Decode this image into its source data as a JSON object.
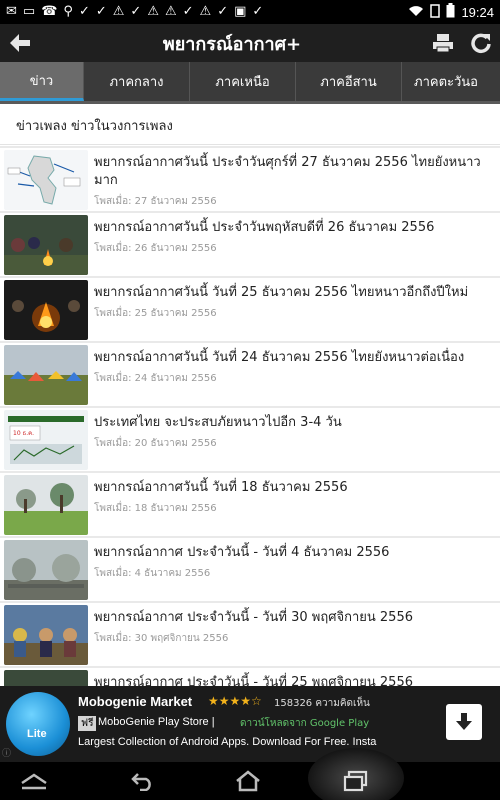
{
  "status_bar": {
    "left_icons": [
      "✉",
      "▭",
      "☎",
      "⚲",
      "✓",
      "✓",
      "⚠",
      "✓",
      "⚠",
      "⚠",
      "✓",
      "⚠",
      "✓",
      "▣",
      "✓"
    ],
    "time": "19:24"
  },
  "action_bar": {
    "title": "พยากรณ์อากาศ+",
    "back_icon": "arrow-left-icon",
    "print_icon": "printer-icon",
    "refresh_icon": "refresh-icon"
  },
  "tabs": [
    {
      "label": "ข่าว",
      "active": true
    },
    {
      "label": "ภาคกลาง",
      "active": false
    },
    {
      "label": "ภาคเหนือ",
      "active": false
    },
    {
      "label": "ภาคอีสาน",
      "active": false
    },
    {
      "label": "ภาคตะวันอ",
      "active": false
    }
  ],
  "section_title": "ข่าวเพลง ข่าวในวงการเพลง",
  "news": [
    {
      "headline": "พยากรณ์อากาศวันนี้ ประจำวันศุกร์ที่ 27 ธันวาคม 2556 ไทยยังหนาวมาก",
      "date": "โพสเมื่อ: 27 ธันวาคม 2556",
      "thumb": "map"
    },
    {
      "headline": "พยากรณ์อากาศวันนี้ ประจำวันพฤหัสบดีที่ 26 ธันวาคม 2556",
      "date": "โพสเมื่อ: 26 ธันวาคม 2556",
      "thumb": "fire"
    },
    {
      "headline": "พยากรณ์อากาศวันนี้ วันที่ 25 ธันวาคม 2556 ไทยหนาวอีกถึงปีใหม่",
      "date": "โพสเมื่อ: 25 ธันวาคม 2556",
      "thumb": "fire2"
    },
    {
      "headline": "พยากรณ์อากาศวันนี้ วันที่ 24 ธันวาคม 2556 ไทยยังหนาวต่อเนื่อง",
      "date": "โพสเมื่อ: 24 ธันวาคม 2556",
      "thumb": "tents"
    },
    {
      "headline": "ประเทศไทย จะประสบภัยหนาวไปอีก 3-4 วัน",
      "date": "โพสเมื่อ: 20 ธันวาคม 2556",
      "thumb": "chart"
    },
    {
      "headline": "พยากรณ์อากาศวันนี้ วันที่ 18 ธันวาคม 2556",
      "date": "โพสเมื่อ: 18 ธันวาคม 2556",
      "thumb": "fog"
    },
    {
      "headline": "พยากรณ์อากาศ ประจำวันนี้ - วันที่ 4 ธันวาคม 2556",
      "date": "โพสเมื่อ: 4 ธันวาคม 2556",
      "thumb": "mist"
    },
    {
      "headline": "พยากรณ์อากาศ ประจำวันนี้ - วันที่ 30 พฤศจิกายน 2556",
      "date": "โพสเมื่อ: 30 พฤศจิกายน 2556",
      "thumb": "people"
    },
    {
      "headline": "พยากรณ์อากาศ ประจำวันนี้ - วันที่ 25 พฤศจิกายน 2556",
      "date": "",
      "thumb": "fire"
    }
  ],
  "ad": {
    "title": "Mobogenie Market",
    "stars": "★★★★☆",
    "reviews": "158326 ความคิดเห็น",
    "free_label": "ฟรี",
    "store": "MoboGenie Play Store |",
    "google_play": "ดาวน์โหลดจาก Google Play",
    "description": "Largest Collection of Android Apps. Download For Free. Insta",
    "logo_text": "Lite"
  },
  "colors": {
    "accent": "#2f9bd6",
    "action_bar": "#1f1f1f",
    "tab_bar": "#3a3a3a",
    "tab_active": "#6b6b6b"
  }
}
